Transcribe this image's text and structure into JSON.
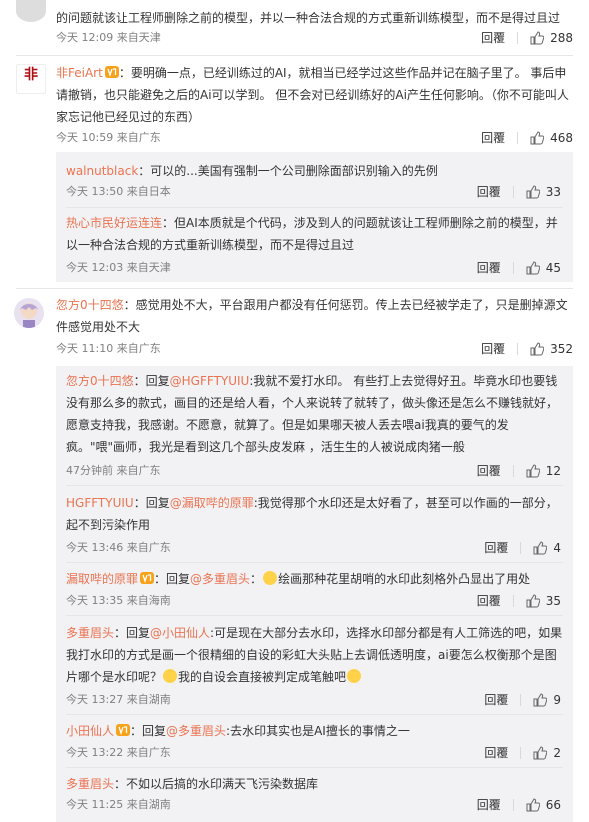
{
  "c0": {
    "text": "的问题就该让工程师删除之前的模型，并以一种合法合规的方式重新训练模型，而不是得过且过",
    "time": "今天 12:09 来自天津",
    "reply": "回覆",
    "likes": "288"
  },
  "c1": {
    "name": "非FeiArt",
    "text": "：要明确一点，已经训练过的AI，就相当已经学过这些作品并记在脑子里了。 事后申请撤销，也只能避免之后的Ai可以学到。 但不会对已经训练好的Ai产生任何影响。（你不可能叫人家忘记他已经见过的东西）",
    "time": "今天 10:59 来自广东",
    "reply": "回覆",
    "likes": "468",
    "avatar_text": "非"
  },
  "r1a": {
    "name": "walnutblack",
    "text": "：可以的...美国有强制一个公司删除面部识别输入的先例",
    "time": "今天 13:50 来自日本",
    "reply": "回覆",
    "likes": "33"
  },
  "r1b": {
    "name": "热心市民好运连连",
    "text": "：但AI本质就是个代码，涉及到人的问题就该让工程师删除之前的模型，并以一种合法合规的方式重新训练模型，而不是得过且过",
    "time": "今天 12:03 来自天津",
    "reply": "回覆",
    "likes": "45"
  },
  "c2": {
    "name": "忽方0十四悠",
    "text": "：感觉用处不大，平台跟用户都没有任何惩罚。传上去已经被学走了，只是删掉源文件感觉用处不大",
    "time": "今天 11:10 来自广东",
    "reply": "回覆",
    "likes": "352"
  },
  "r2a": {
    "name": "忽方0十四悠",
    "prefix": "：回复",
    "at": "@HGFFTYUIU",
    "text": ":我就不爱打水印。 有些打上去觉得好丑。毕竟水印也要钱没有那么多的款式，画目的还是给人看，个人来说转了就转了，做头像还是怎么不赚钱就好，愿意支持我，我感谢。不愿意，就算了。但是如果哪天被人丢去喂ai我真的要气的发疯。\"喂\"画师，我光是看到这几个部头皮发麻 ，活生生的人被说成肉猪一般",
    "time": "47分钟前 来自广东",
    "reply": "回覆",
    "likes": "12"
  },
  "r2b": {
    "name": "HGFFTYUIU",
    "prefix": "：回复",
    "at": "@漏取哔的原罪",
    "text": ":我觉得那个水印还是太好看了，甚至可以作画的一部分，起不到污染作用",
    "time": "今天 13:46 来自广东",
    "reply": "回覆",
    "likes": "4"
  },
  "r2c": {
    "name": "漏取哔的原罪",
    "prefix": "：回复",
    "at": "@多重眉头",
    "text": "绘画那种花里胡哨的水印此刻格外凸显出了用处",
    "time": "今天 13:35 来自海南",
    "reply": "回覆",
    "likes": "35"
  },
  "r2d": {
    "name": "多重眉头",
    "prefix": "：回复",
    "at": "@小田仙人",
    "text": ":可是现在大部分去水印，选择水印部分都是有人工筛选的吧，如果我打水印的方式是画一个很精细的自设的彩虹大头贴上去调低透明度，ai要怎么权衡那个是图片哪个是水印呢？",
    "text2": "我的自设会直接被判定成笔触吧",
    "time": "今天 13:27 来自湖南",
    "reply": "回覆",
    "likes": "9"
  },
  "r2e": {
    "name": "小田仙人",
    "prefix": "：回复",
    "at": "@多重眉头",
    "text": ":去水印其实也是AI擅长的事情之一",
    "time": "今天 13:22 来自广东",
    "reply": "回覆",
    "likes": "2"
  },
  "r2f": {
    "name": "多重眉头",
    "text": "：不如以后搞的水印满天飞污染数据库",
    "time": "今天 11:25 来自湖南",
    "reply": "回覆",
    "likes": "66"
  },
  "colors": {
    "name": "#eb7350",
    "meta": "#808080",
    "replybg": "#f2f2f5"
  }
}
